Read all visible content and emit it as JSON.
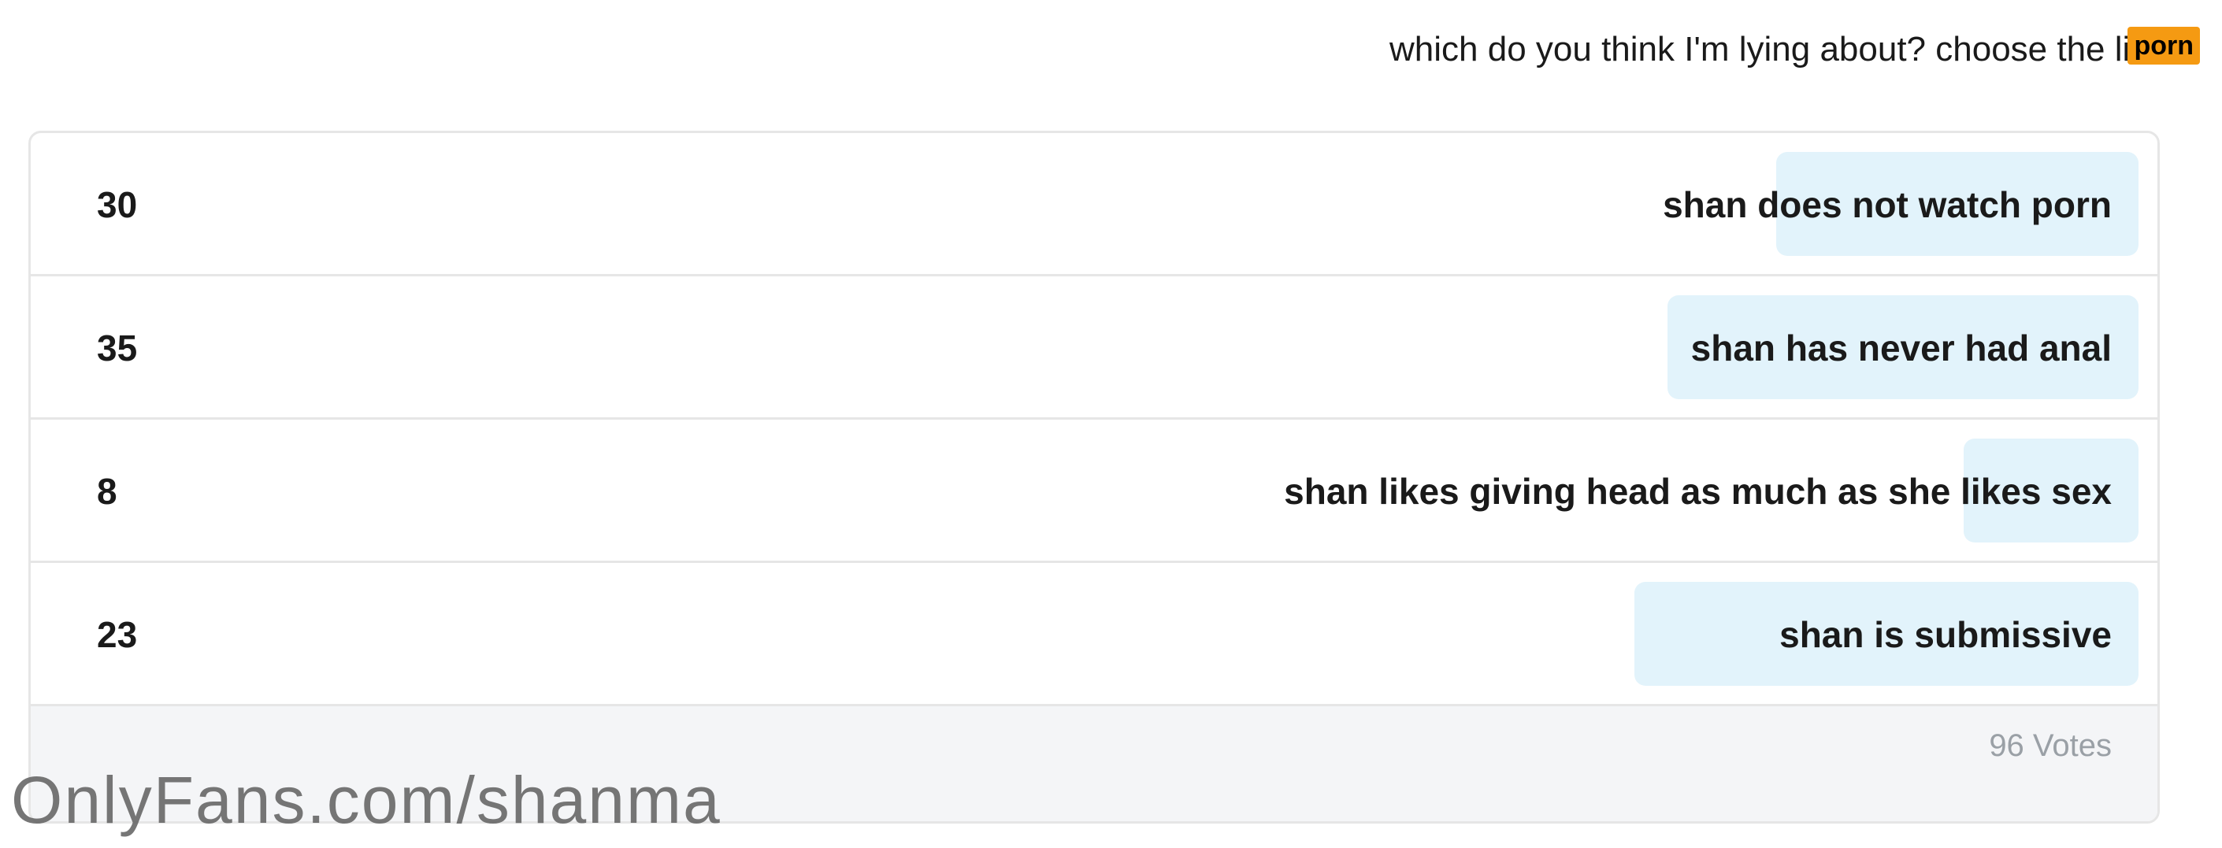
{
  "post": {
    "question": "which do you think I'm lying about? choose the lie.",
    "badge": "porn"
  },
  "poll": {
    "options": [
      {
        "label": "shan does not watch porn",
        "count": "30",
        "fill_fraction": 0.17
      },
      {
        "label": "shan has never had anal",
        "count": "35",
        "fill_fraction": 0.2
      },
      {
        "label": "shan likes giving head as much as she likes sex",
        "count": "8",
        "fill_fraction": 0.045
      },
      {
        "label": "shan is submissive",
        "count": "23",
        "fill_fraction": 0.13
      }
    ],
    "votes_text": "96 Votes"
  },
  "watermark": "OnlyFans.com/shanma",
  "colors": {
    "bar_fill": "#e2f3fb",
    "badge_bg": "#f59a12",
    "footer_bg": "#f4f5f7",
    "border": "#e6e6e6"
  }
}
